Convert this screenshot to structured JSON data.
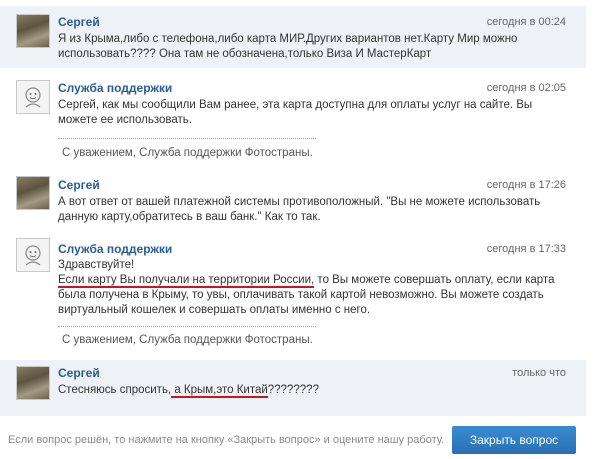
{
  "messages": [
    {
      "author": "Сергей",
      "time": "сегодня в 00:24",
      "text": "Я из Крыма,либо с телефона,либо карта МИР.Других вариантов нет.Карту Мир можно использовать???? Она там не обозначена,только Виза И МастерКарт"
    },
    {
      "author": "Служба поддержки",
      "time": "сегодня в 02:05",
      "text": "Сергей, как мы сообщили Вам ранее, эта карта доступна для оплаты услуг на сайте. Вы можете ее использовать.",
      "signature": "С уважением, Служба поддержки Фотостраны."
    },
    {
      "author": "Сергей",
      "time": "сегодня в 17:26",
      "text": "А вот ответ от вашей платежной системы противоположный. \"Вы не можете использовать данную карту,обратитесь в ваш банк.\" Как то так."
    },
    {
      "author": "Служба поддержки",
      "time": "сегодня в 17:33",
      "text_line1": "Здравствуйте!",
      "text_part_underlined": "Если карту Вы получали на территории России,",
      "text_rest": " то Вы можете совершать оплату, если карта была получена в Крыму, то увы, оплачивать такой картой невозможно. Вы можете создать виртуальный кошелек и совершать оплаты именно с него.",
      "signature": "С уважением, Служба поддержки Фотостраны."
    },
    {
      "author": "Сергей",
      "time": "только что",
      "text_before": "Стесняюсь спросить,",
      "text_underlined": " а Крым,это Китай",
      "text_after": "????????"
    }
  ],
  "footer": {
    "hint": "Если вопрос решён, то нажмите на кнопку «Закрыть вопрос» и оцените нашу работу.",
    "close_button": "Закрыть вопрос"
  },
  "colors": {
    "name": "#2a5d96",
    "highlight_bg": "#eef1f6",
    "button": "#2f7cc2",
    "underline": "#d0141f"
  }
}
